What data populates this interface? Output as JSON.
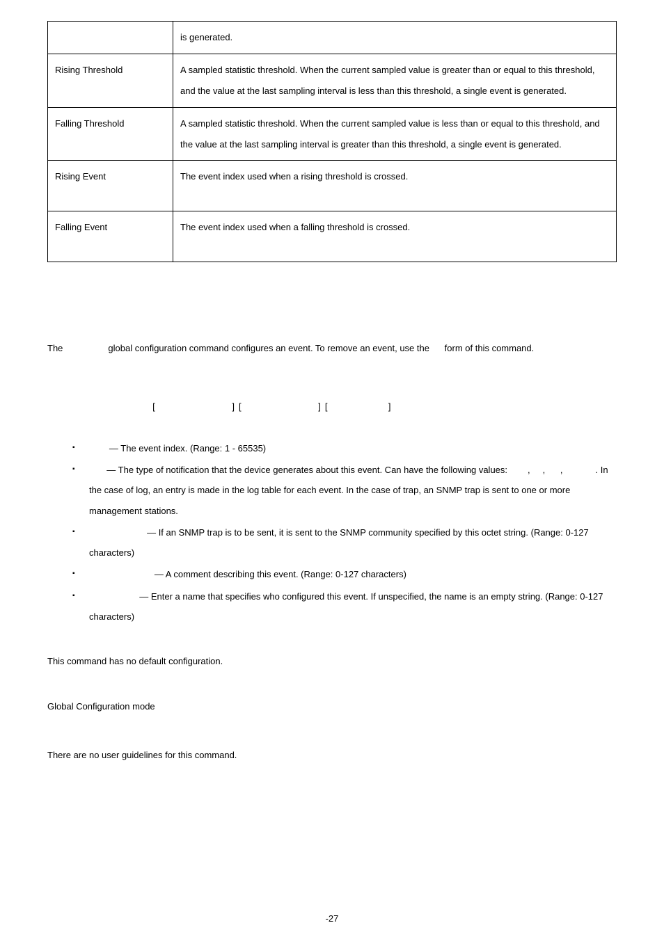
{
  "table": {
    "r0": {
      "label": "",
      "desc": "is generated."
    },
    "r1": {
      "label": "Rising Threshold",
      "desc": "A sampled statistic threshold. When the current sampled value is greater than or equal to this threshold, and the value at the last sampling interval is less than this threshold, a single event is generated."
    },
    "r2": {
      "label": "Falling Threshold",
      "desc": "A sampled statistic threshold. When the current sampled value is less than or equal to this threshold, and the value at the last sampling interval is greater than this threshold, a single event is generated."
    },
    "r3": {
      "label": "Rising Event",
      "desc": "The event index used when a rising threshold is crossed."
    },
    "r4": {
      "label": "Falling Event",
      "desc": "The event index used when a falling threshold is crossed."
    }
  },
  "desc": {
    "p1a": "The ",
    "p1b": " global configuration command configures an event. To remove an event, use the ",
    "p1c": " form of this command."
  },
  "syntax": "                          [                   ] [                   ] [               ]",
  "params": {
    "index": " — The event index. (Range: 1 - 65535)",
    "type_a": " — The type of notification that the device generates about this event. Can have the following values: ",
    "type_b": ", ",
    "type_c": ", ",
    "type_d": ", ",
    "type_e": ". In the case of log, an entry is made in the log table for each event. In the case of trap, an SNMP trap is sent to one or more management stations.",
    "community": " — If an SNMP trap is to be sent, it is sent to the SNMP community specified by this octet string. (Range: 0-127 characters)",
    "description": " — A comment describing this event. (Range: 0-127 characters)",
    "owner": " — Enter a name that specifies who configured this event. If unspecified, the name is an empty string. (Range: 0-127 characters)"
  },
  "default_cfg": "This command has no default configuration.",
  "mode": "Global Configuration mode",
  "guidelines": "There are no user guidelines for this command.",
  "pagenum": "-27"
}
